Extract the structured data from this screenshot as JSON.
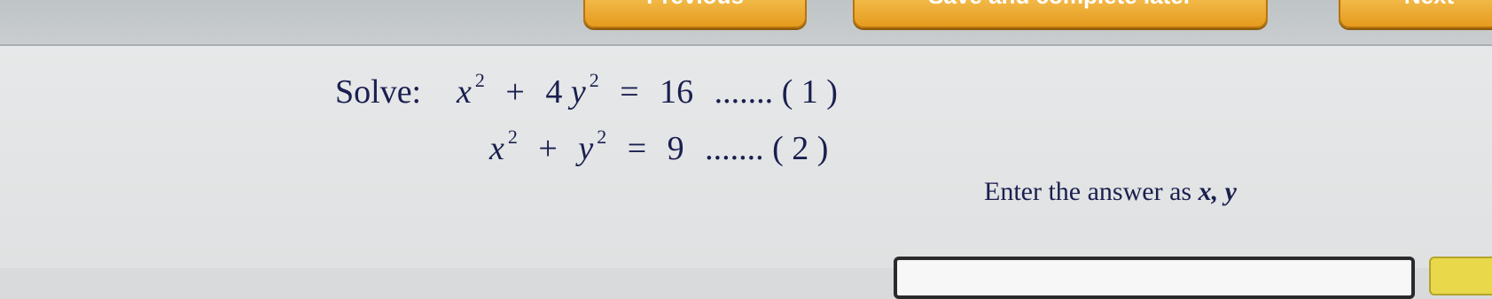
{
  "toolbar": {
    "previous_label": "Previous",
    "save_label": "Save and complete later",
    "next_label": "Next"
  },
  "problem": {
    "solve_label": "Solve:",
    "equation1": {
      "term_a": "x",
      "exp_a": "2",
      "plus": "+",
      "coef_b": "4",
      "term_b": "y",
      "exp_b": "2",
      "equals": "=",
      "rhs": "16",
      "dots": ".......",
      "tag": "( 1 )"
    },
    "equation2": {
      "term_a": "x",
      "exp_a": "2",
      "plus": "+",
      "term_b": "y",
      "exp_b": "2",
      "equals": "=",
      "rhs": "9",
      "dots": ".......",
      "tag": "( 2 )"
    }
  },
  "instruction": {
    "text": "Enter the answer as ",
    "format": "x, y"
  },
  "colors": {
    "text": "#1a1f4f",
    "button": "#e69b1e",
    "background": "#dfe1e2"
  }
}
